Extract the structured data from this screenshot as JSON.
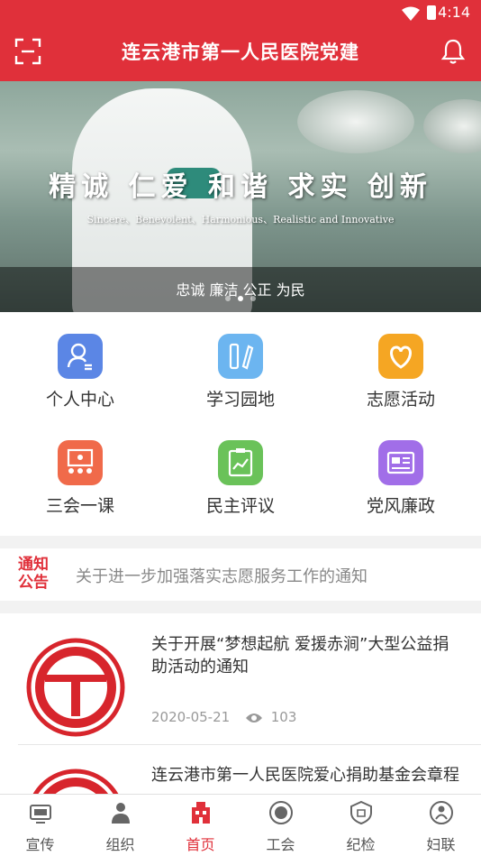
{
  "status": {
    "time": "4:14"
  },
  "header": {
    "title": "连云港市第一人民医院党建"
  },
  "banner": {
    "slogan": "精诚 仁爱 和谐 求实 创新",
    "slogan_en": "Sincere、Benevolent、Harmonious、Realistic and Innovative",
    "caption": "忠诚 廉洁 公正 为民",
    "page_count": 3,
    "active_index": 1
  },
  "grid": [
    {
      "label": "个人中心",
      "icon": "person-icon",
      "color": "#5b86e5"
    },
    {
      "label": "学习园地",
      "icon": "pencil-ruler-icon",
      "color": "#6cb5f0"
    },
    {
      "label": "志愿活动",
      "icon": "heart-icon",
      "color": "#f5a623"
    },
    {
      "label": "三会一课",
      "icon": "meeting-icon",
      "color": "#f06a4a"
    },
    {
      "label": "民主评议",
      "icon": "clipboard-chart-icon",
      "color": "#6ac259"
    },
    {
      "label": "党风廉政",
      "icon": "newspaper-icon",
      "color": "#a16ee8"
    }
  ],
  "notice": {
    "tag_line1": "通知",
    "tag_line2": "公告",
    "text": "关于进一步加强落实志愿服务工作的通知"
  },
  "news": [
    {
      "title": "关于开展“梦想起航 爱援赤涧”大型公益捐助活动的通知",
      "date": "2020-05-21",
      "views": "103"
    },
    {
      "title": "连云港市第一人民医院爱心捐助基金会章程",
      "date": "",
      "views": ""
    }
  ],
  "bottom_nav": [
    {
      "label": "宣传",
      "icon": "tv-icon",
      "active": false
    },
    {
      "label": "组织",
      "icon": "group-icon",
      "active": false
    },
    {
      "label": "首页",
      "icon": "home-building-icon",
      "active": true
    },
    {
      "label": "工会",
      "icon": "union-icon",
      "active": false
    },
    {
      "label": "纪检",
      "icon": "discipline-badge-icon",
      "active": false
    },
    {
      "label": "妇联",
      "icon": "women-federation-icon",
      "active": false
    }
  ],
  "colors": {
    "primary": "#e0303a",
    "inactive_tab": "#555555"
  }
}
